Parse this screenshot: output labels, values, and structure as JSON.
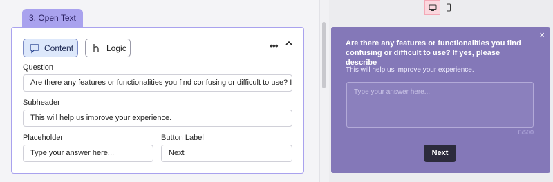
{
  "editor": {
    "question_tab": "3. Open Text",
    "tabs": {
      "content_label": "Content",
      "logic_label": "Logic"
    },
    "more_label": "•••",
    "fields": {
      "question": {
        "label": "Question",
        "value": "Are there any features or functionalities you find confusing or difficult to use? If ye"
      },
      "subheader": {
        "label": "Subheader",
        "value": "This will help us improve your experience."
      },
      "placeholder": {
        "label": "Placeholder",
        "value": "Type your answer here..."
      },
      "button_label": {
        "label": "Button Label",
        "value": "Next"
      }
    }
  },
  "preview": {
    "device_selected": "desktop",
    "title": "Are there any features or functionalities you find confusing or difficult to use? If yes, please describe",
    "subtitle": "This will help us improve your experience.",
    "placeholder": "Type your answer here...",
    "char_count": "0/500",
    "next_label": "Next",
    "close_label": "×",
    "accent_color": "#8478b8"
  }
}
